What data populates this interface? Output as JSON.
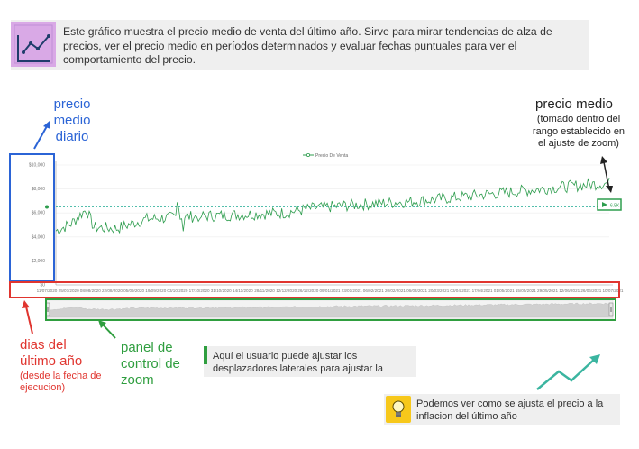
{
  "intro": {
    "text": "Este gráfico muestra el precio medio de venta del último año. Sirve para mirar tendencias de alza de precios, ver el precio medio en períodos determinados y evaluar fechas puntuales para ver el comportamiento del precio.",
    "icon": "line-chart-icon"
  },
  "annotations": {
    "precio_diario": "precio medio diario",
    "precio_medio": "precio medio",
    "precio_medio_sub": "(tomado dentro del rango establecido en el ajuste de zoom)",
    "dias": "dias del último año",
    "dias_sub": "(desde la fecha de ejecucion)",
    "panel": "panel de control de zoom"
  },
  "zoom_note": {
    "text": "Aquí el usuario puede ajustar los desplazadores laterales para ajustar la"
  },
  "tip": {
    "text": "Podemos ver como se ajusta el precio a la inflacion del último año",
    "icon": "lightbulb-icon"
  },
  "colors": {
    "blue": "#2b64d6",
    "red": "#e0352f",
    "green": "#2f9e3f",
    "series": "#2e9d4e",
    "teal": "#3bb5a0"
  },
  "chart_data": {
    "type": "line",
    "legend": "Precio De Venta",
    "legend_position": "top-center",
    "ylim": [
      0,
      10000
    ],
    "y_ticks": [
      "$10,000",
      "$8,000",
      "$6,000",
      "$4,000",
      "$2,000",
      "$0"
    ],
    "x_ticks": [
      "11/07/2020",
      "25/07/2020",
      "08/08/2020",
      "22/08/2020",
      "05/09/2020",
      "19/09/2020",
      "03/10/2020",
      "17/10/2020",
      "31/10/2020",
      "14/11/2020",
      "28/11/2020",
      "12/12/2020",
      "26/12/2020",
      "09/01/2021",
      "23/01/2021",
      "06/02/2021",
      "20/02/2021",
      "06/03/2021",
      "20/03/2021",
      "03/04/2021",
      "17/04/2021",
      "01/05/2021",
      "15/05/2021",
      "29/05/2021",
      "12/06/2021",
      "26/06/2021",
      "10/07/2021"
    ],
    "anchor_points": [
      [
        0,
        4500
      ],
      [
        10,
        5100
      ],
      [
        20,
        6300
      ],
      [
        25,
        4800
      ],
      [
        40,
        4700
      ],
      [
        60,
        5500
      ],
      [
        90,
        5700
      ],
      [
        120,
        5850
      ],
      [
        150,
        6000
      ],
      [
        170,
        6400
      ],
      [
        200,
        6700
      ],
      [
        240,
        7000
      ],
      [
        280,
        7500
      ],
      [
        320,
        8000
      ],
      [
        350,
        8350
      ],
      [
        365,
        8500
      ]
    ],
    "noise_amplitude": 500,
    "average": 6500,
    "average_label": "6.5K",
    "grid": true
  }
}
